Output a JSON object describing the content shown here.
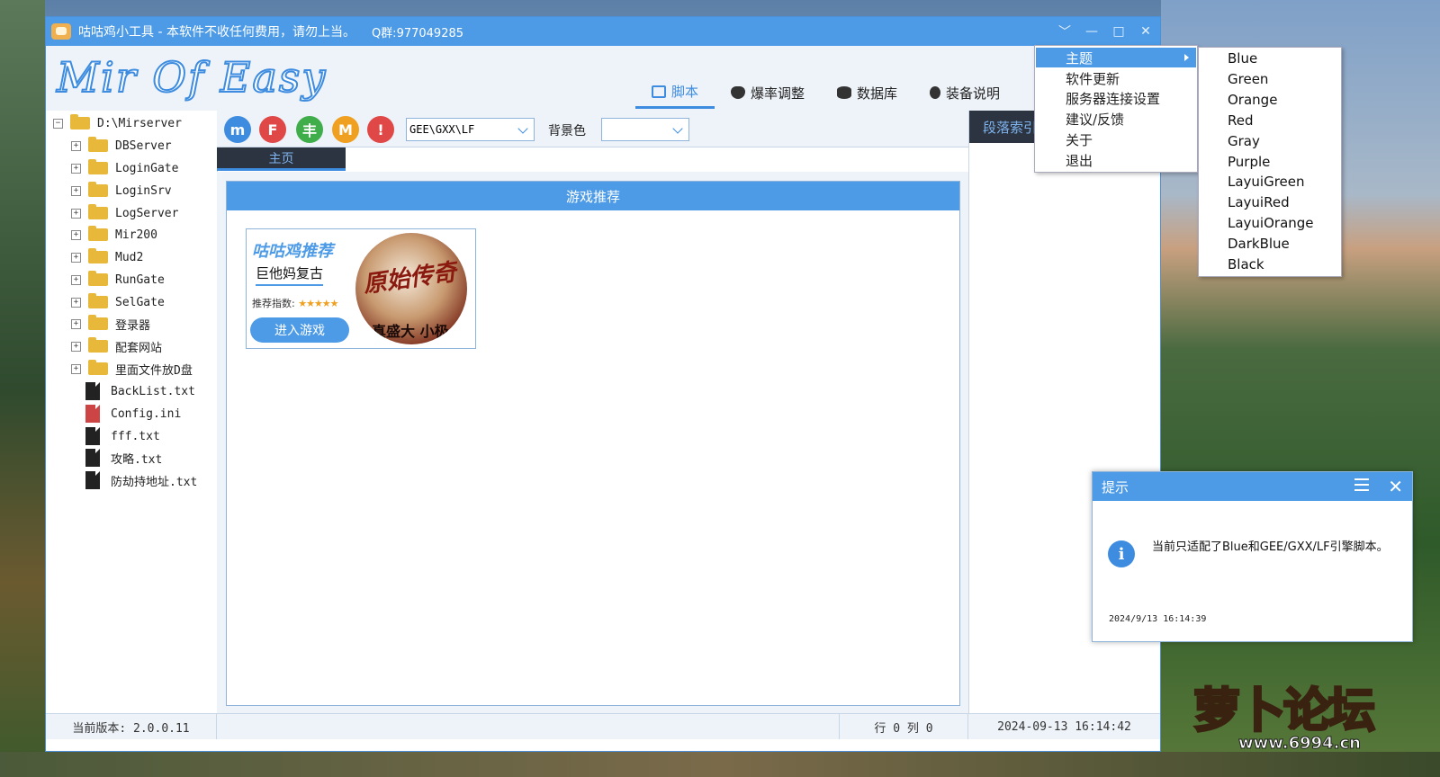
{
  "window": {
    "title": "咕咕鸡小工具 - 本软件不收任何费用，请勿上当。",
    "qq": "Q群:977049285",
    "controls": [
      "﹀",
      "—",
      "□",
      "✕"
    ]
  },
  "header": {
    "logo": "Mir Of Easy",
    "tabs": [
      {
        "label": "脚本",
        "icon": "monitor-icon"
      },
      {
        "label": "爆率调整",
        "icon": "shield-icon"
      },
      {
        "label": "数据库",
        "icon": "database-icon"
      },
      {
        "label": "装备说明",
        "icon": "bug-icon"
      }
    ]
  },
  "tree": {
    "root": "D:\\Mirserver",
    "folders": [
      "DBServer",
      "LoginGate",
      "LoginSrv",
      "LogServer",
      "Mir200",
      "Mud2",
      "RunGate",
      "SelGate",
      "登录器",
      "配套网站",
      "里面文件放D盘"
    ],
    "files": [
      "BackList.txt",
      "Config.ini",
      "fff.txt",
      "攻略.txt",
      "防劫持地址.txt"
    ]
  },
  "toolbar": {
    "buttons": [
      {
        "glyph": "m",
        "color": "#3d8ce0"
      },
      {
        "glyph": "F",
        "color": "#e04848"
      },
      {
        "glyph": "丰",
        "color": "#3fae4a"
      },
      {
        "glyph": "M",
        "color": "#f0a020"
      },
      {
        "glyph": "!",
        "color": "#e04848"
      }
    ],
    "engine_value": "GEE\\GXX\\LF",
    "bg_label": "背景色",
    "bg_value": ""
  },
  "main": {
    "tab": "主页",
    "panel_title": "游戏推荐",
    "card": {
      "title": "咕咕鸡推荐",
      "name": "巨他妈复古",
      "rate_label": "推荐指数:",
      "stars": "★★★★★",
      "button": "进入游戏",
      "image_title": "原始传奇",
      "image_sub": "真盛大 小极"
    }
  },
  "right_pane": {
    "tab": "段落索引"
  },
  "status": {
    "version": "当前版本: 2.0.0.11",
    "middle": "",
    "cursor": "行 0 列 0",
    "datetime": "2024-09-13 16:14:42"
  },
  "menu": {
    "items": [
      "主题",
      "软件更新",
      "服务器连接设置",
      "建议/反馈",
      "关于",
      "退出"
    ],
    "theme_options": [
      "Blue",
      "Green",
      "Orange",
      "Red",
      "Gray",
      "Purple",
      "LayuiGreen",
      "LayuiRed",
      "LayuiOrange",
      "DarkBlue",
      "Black"
    ]
  },
  "toast": {
    "title": "提示",
    "message": "当前只适配了Blue和GEE/GXX/LF引擎脚本。",
    "time": "2024/9/13 16:14:39"
  },
  "watermark": {
    "text": "萝卜论坛",
    "url": "www.6994.cn"
  }
}
